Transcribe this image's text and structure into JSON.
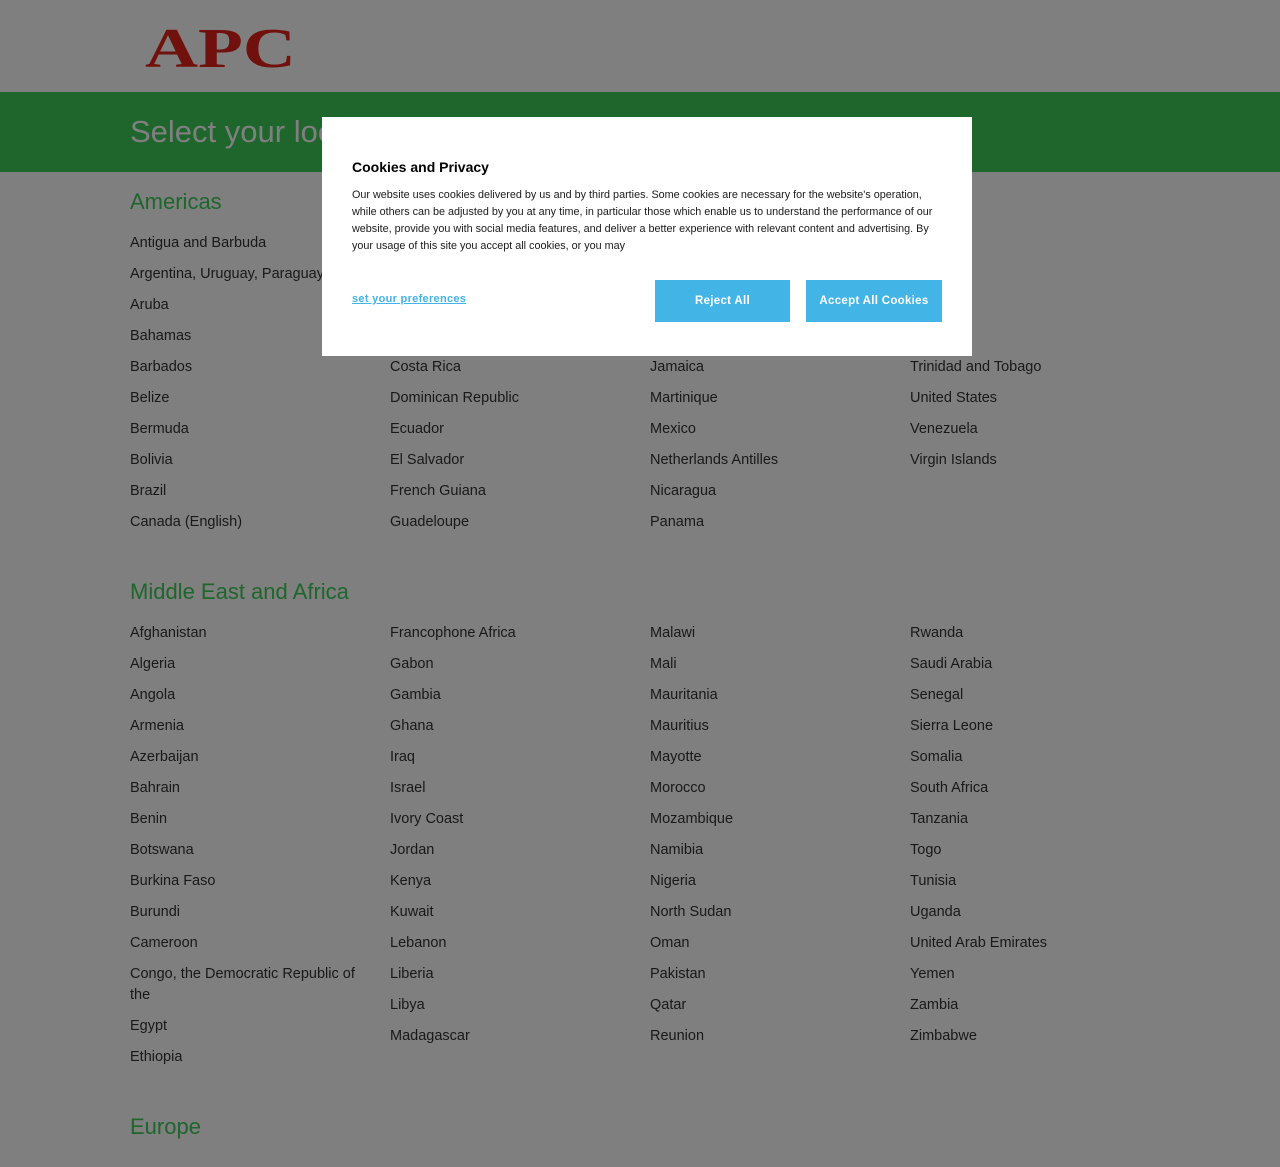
{
  "colors": {
    "brand_red": "#e2231a",
    "banner_green": "#3dcd58",
    "region_green": "#3dcd58",
    "button_blue": "#42b4e6",
    "link_blue": "#42b4e6"
  },
  "header": {
    "logo_text": "APC"
  },
  "banner": {
    "title": "Select your location"
  },
  "regions": [
    {
      "title": "Americas",
      "columns": [
        [
          "Antigua and Barbuda",
          "Argentina, Uruguay, Paraguay",
          "Aruba",
          "Bahamas",
          "Barbados",
          "Belize",
          "Bermuda",
          "Bolivia",
          "Brazil",
          "Canada (English)"
        ],
        [
          "",
          "",
          "",
          "",
          "Costa Rica",
          "Dominican Republic",
          "Ecuador",
          "El Salvador",
          "French Guiana",
          "Guadeloupe"
        ],
        [
          "",
          "",
          "",
          "",
          "Jamaica",
          "Martinique",
          "Mexico",
          "Netherlands Antilles",
          "Nicaragua",
          "Panama"
        ],
        [
          "",
          "",
          "",
          "",
          "Trinidad and Tobago",
          "United States",
          "Venezuela",
          "Virgin Islands"
        ]
      ]
    },
    {
      "title": "Middle East and Africa",
      "columns": [
        [
          "Afghanistan",
          "Algeria",
          "Angola",
          "Armenia",
          "Azerbaijan",
          "Bahrain",
          "Benin",
          "Botswana",
          "Burkina Faso",
          "Burundi",
          "Cameroon",
          "Congo, the Democratic Republic of the",
          "Egypt",
          "Ethiopia"
        ],
        [
          "Francophone Africa",
          "Gabon",
          "Gambia",
          "Ghana",
          "Iraq",
          "Israel",
          "Ivory Coast",
          "Jordan",
          "Kenya",
          "Kuwait",
          "Lebanon",
          "Liberia",
          "Libya",
          "Madagascar"
        ],
        [
          "Malawi",
          "Mali",
          "Mauritania",
          "Mauritius",
          "Mayotte",
          "Morocco",
          "Mozambique",
          "Namibia",
          "Nigeria",
          "North Sudan",
          "Oman",
          "Pakistan",
          "Qatar",
          "Reunion"
        ],
        [
          "Rwanda",
          "Saudi Arabia",
          "Senegal",
          "Sierra Leone",
          "Somalia",
          "South Africa",
          "Tanzania",
          "Togo",
          "Tunisia",
          "Uganda",
          "United Arab Emirates",
          "Yemen",
          "Zambia",
          "Zimbabwe"
        ]
      ]
    },
    {
      "title": "Europe",
      "columns": []
    }
  ],
  "cookie_dialog": {
    "title": "Cookies and Privacy",
    "text": "Our website uses cookies delivered by us and by third parties. Some cookies are necessary for the website's operation, while others can be adjusted by you at any time, in particular those which enable us to understand the performance of our website, provide you with social media features, and deliver a better experience with relevant content and advertising. By your usage of this site you accept all cookies, or you may",
    "preferences_link": "set your preferences",
    "reject_label": "Reject All",
    "accept_label": "Accept All Cookies"
  }
}
